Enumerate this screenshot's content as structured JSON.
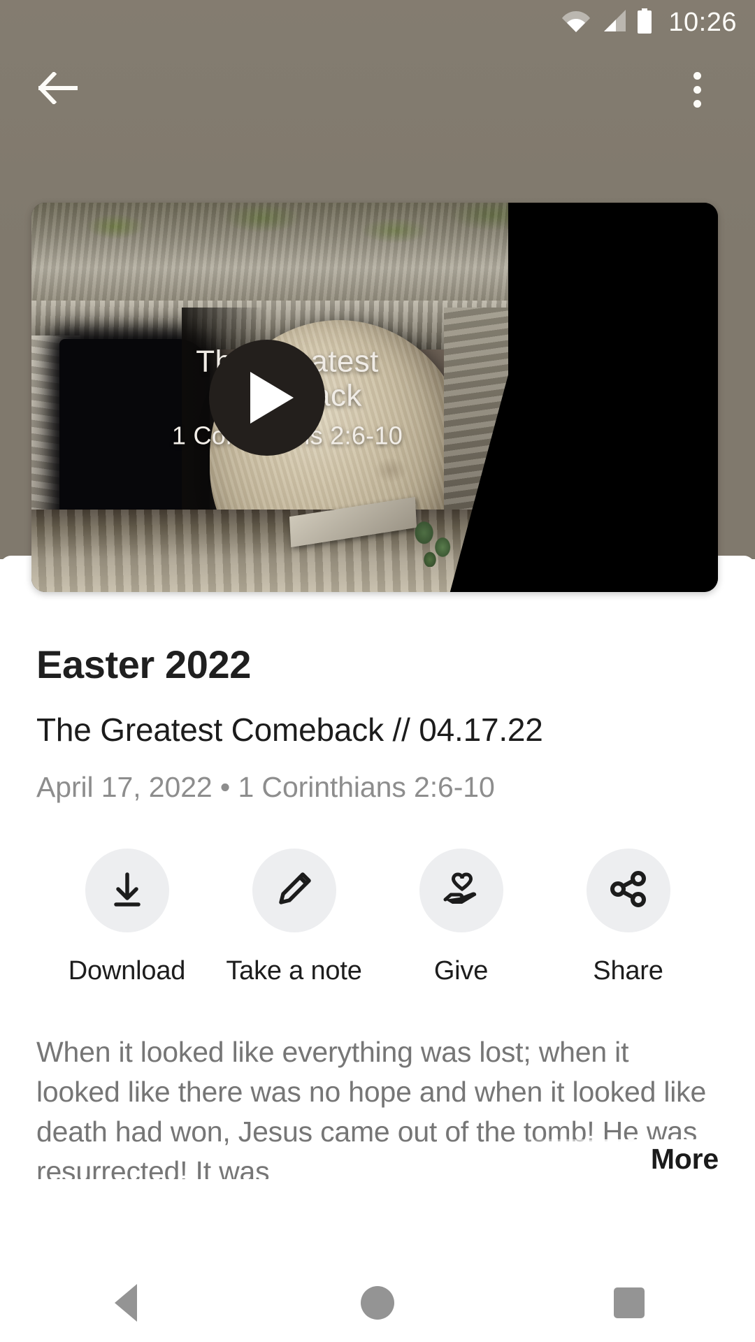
{
  "status_bar": {
    "time": "10:26",
    "icons": [
      "wifi-icon",
      "cellular-signal-icon",
      "battery-icon"
    ]
  },
  "app_bar": {
    "back_label": "back-arrow-icon",
    "overflow_label": "overflow-menu-icon"
  },
  "video": {
    "overlay_title_line1": "The Greatest",
    "overlay_title_line2": "Comeback",
    "overlay_subtitle": "1 Corinthians 2:6-10",
    "play_label": "play-icon"
  },
  "message": {
    "series_title": "Easter 2022",
    "title": "The Greatest Comeback // 04.17.22",
    "meta": "April 17, 2022 • 1 Corinthians 2:6-10"
  },
  "actions": [
    {
      "id": "download",
      "icon": "download-icon",
      "label": "Download"
    },
    {
      "id": "note",
      "icon": "pencil-icon",
      "label": "Take a note"
    },
    {
      "id": "give",
      "icon": "hand-heart-icon",
      "label": "Give"
    },
    {
      "id": "share",
      "icon": "share-icon",
      "label": "Share"
    }
  ],
  "description": {
    "text": "When it looked like everything was lost; when it looked like there was no hope and when it looked like death had won, Jesus came out of the tomb! He was resurrected! It was",
    "more_label": "More"
  },
  "nav_bar": {
    "back": "nav-back-icon",
    "home": "nav-home-icon",
    "recents": "nav-recents-icon"
  },
  "colors": {
    "backdrop": "#80796d",
    "sheet": "#ffffff",
    "action_circle": "#edeef0",
    "muted_text": "#8d8d8d",
    "body_text": "#767676",
    "heading_text": "#1f1f1f",
    "nav_icon": "#949494"
  }
}
